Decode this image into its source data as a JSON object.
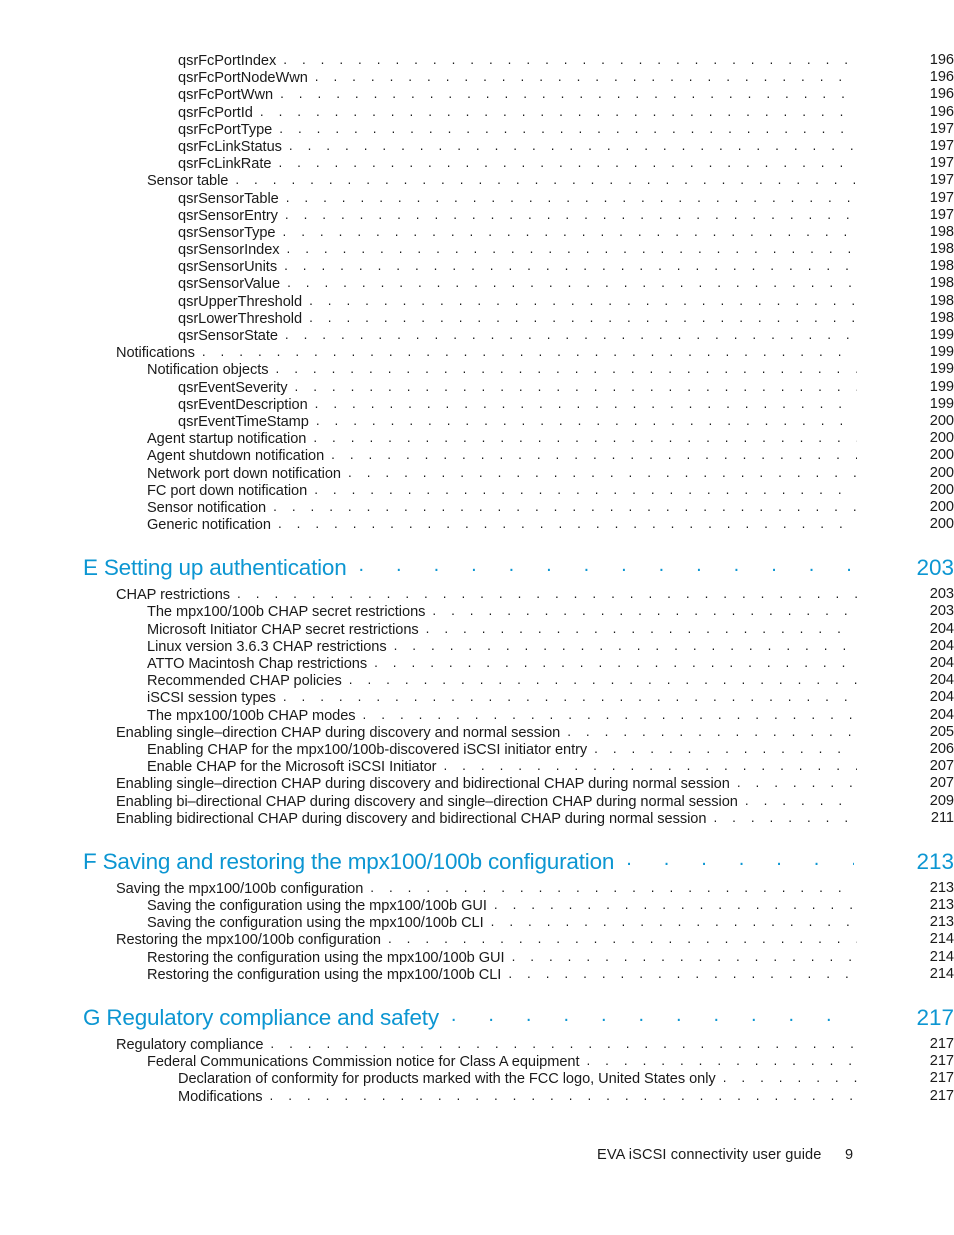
{
  "document": {
    "type": "table-of-contents",
    "footer": {
      "title": "EVA iSCSI connectivity user guide",
      "page_number": "9"
    },
    "accent_color": "#0c96d2",
    "text_color": "#1a1a1a"
  },
  "toc": {
    "blocks": [
      {
        "kind": "entries",
        "entries": [
          {
            "level": 3,
            "label": "qsrFcPortIndex",
            "page": "196"
          },
          {
            "level": 3,
            "label": "qsrFcPortNodeWwn",
            "page": "196"
          },
          {
            "level": 3,
            "label": "qsrFcPortWwn",
            "page": "196"
          },
          {
            "level": 3,
            "label": "qsrFcPortId",
            "page": "196"
          },
          {
            "level": 3,
            "label": "qsrFcPortType",
            "page": "197"
          },
          {
            "level": 3,
            "label": "qsrFcLinkStatus",
            "page": "197"
          },
          {
            "level": 3,
            "label": "qsrFcLinkRate",
            "page": "197"
          },
          {
            "level": 2,
            "label": "Sensor table",
            "page": "197"
          },
          {
            "level": 3,
            "label": "qsrSensorTable",
            "page": "197"
          },
          {
            "level": 3,
            "label": "qsrSensorEntry",
            "page": "197"
          },
          {
            "level": 3,
            "label": "qsrSensorType",
            "page": "198"
          },
          {
            "level": 3,
            "label": "qsrSensorIndex",
            "page": "198"
          },
          {
            "level": 3,
            "label": "qsrSensorUnits",
            "page": "198"
          },
          {
            "level": 3,
            "label": "qsrSensorValue",
            "page": "198"
          },
          {
            "level": 3,
            "label": "qsrUpperThreshold",
            "page": "198"
          },
          {
            "level": 3,
            "label": "qsrLowerThreshold",
            "page": "198"
          },
          {
            "level": 3,
            "label": "qsrSensorState",
            "page": "199"
          },
          {
            "level": 1,
            "label": "Notifications",
            "page": "199"
          },
          {
            "level": 2,
            "label": "Notification objects",
            "page": "199"
          },
          {
            "level": 3,
            "label": "qsrEventSeverity",
            "page": "199"
          },
          {
            "level": 3,
            "label": "qsrEventDescription",
            "page": "199"
          },
          {
            "level": 3,
            "label": "qsrEventTimeStamp",
            "page": "200"
          },
          {
            "level": 2,
            "label": "Agent startup notification",
            "page": "200"
          },
          {
            "level": 2,
            "label": "Agent shutdown notification",
            "page": "200"
          },
          {
            "level": 2,
            "label": "Network port down notification",
            "page": "200"
          },
          {
            "level": 2,
            "label": "FC port down notification",
            "page": "200"
          },
          {
            "level": 2,
            "label": "Sensor notification",
            "page": "200"
          },
          {
            "level": 2,
            "label": "Generic notification",
            "page": "200"
          }
        ]
      },
      {
        "kind": "chapter",
        "label": "E Setting up authentication",
        "page": "203",
        "entries": [
          {
            "level": 1,
            "label": "CHAP restrictions",
            "page": "203"
          },
          {
            "level": 2,
            "label": "The mpx100/100b CHAP secret restrictions",
            "page": "203"
          },
          {
            "level": 2,
            "label": "Microsoft Initiator CHAP secret restrictions",
            "page": "204"
          },
          {
            "level": 2,
            "label": "Linux version 3.6.3 CHAP restrictions",
            "page": "204"
          },
          {
            "level": 2,
            "label": "ATTO Macintosh Chap restrictions",
            "page": "204"
          },
          {
            "level": 2,
            "label": "Recommended CHAP policies",
            "page": "204"
          },
          {
            "level": 2,
            "label": "iSCSI session types",
            "page": "204"
          },
          {
            "level": 2,
            "label": "The mpx100/100b CHAP modes",
            "page": "204"
          },
          {
            "level": 1,
            "label": "Enabling single–direction CHAP during discovery and normal session",
            "page": "205"
          },
          {
            "level": 2,
            "label": "Enabling CHAP for the mpx100/100b-discovered iSCSI initiator entry",
            "page": "206"
          },
          {
            "level": 2,
            "label": "Enable CHAP for the Microsoft iSCSI Initiator",
            "page": "207"
          },
          {
            "level": 1,
            "label": "Enabling single–direction CHAP during discovery and bidirectional CHAP during normal session",
            "page": "207"
          },
          {
            "level": 1,
            "label": "Enabling bi–directional CHAP during discovery and single–direction CHAP during normal session",
            "page": "209"
          },
          {
            "level": 1,
            "label": "Enabling bidirectional CHAP during discovery and bidirectional CHAP during normal session",
            "page": "211"
          }
        ]
      },
      {
        "kind": "chapter",
        "label": "F Saving and restoring the mpx100/100b configuration",
        "page": "213",
        "entries": [
          {
            "level": 1,
            "label": "Saving the mpx100/100b configuration",
            "page": "213"
          },
          {
            "level": 2,
            "label": "Saving the configuration using the mpx100/100b GUI",
            "page": "213"
          },
          {
            "level": 2,
            "label": "Saving the configuration using the mpx100/100b CLI",
            "page": "213"
          },
          {
            "level": 1,
            "label": "Restoring the mpx100/100b configuration",
            "page": "214"
          },
          {
            "level": 2,
            "label": "Restoring the configuration using the mpx100/100b GUI",
            "page": "214"
          },
          {
            "level": 2,
            "label": "Restoring the configuration using the mpx100/100b CLI",
            "page": "214"
          }
        ]
      },
      {
        "kind": "chapter",
        "label": "G Regulatory compliance and safety",
        "page": "217",
        "entries": [
          {
            "level": 1,
            "label": "Regulatory compliance",
            "page": "217"
          },
          {
            "level": 2,
            "label": "Federal Communications Commission notice for Class A equipment",
            "page": "217"
          },
          {
            "level": 3,
            "label": "Declaration of conformity for products marked with the FCC logo, United States only",
            "page": "217"
          },
          {
            "level": 3,
            "label": "Modifications",
            "page": "217"
          }
        ]
      }
    ]
  }
}
